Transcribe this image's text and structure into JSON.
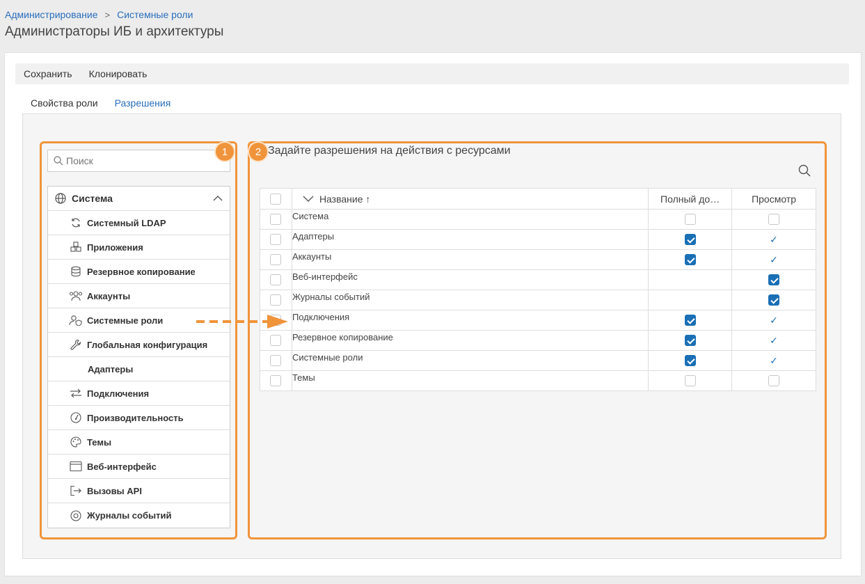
{
  "breadcrumb": {
    "root": "Администрирование",
    "current": "Системные роли"
  },
  "page_title": "Администраторы ИБ и архитектуры",
  "toolbar": {
    "save_label": "Сохранить",
    "clone_label": "Клонировать"
  },
  "tabs": [
    {
      "label": "Свойства роли"
    },
    {
      "label": "Разрешения"
    }
  ],
  "left": {
    "search_placeholder": "Поиск",
    "group_label": "Система",
    "items": [
      {
        "label": "Системный LDAP",
        "icon": "sync-icon"
      },
      {
        "label": "Приложения",
        "icon": "cubes-icon"
      },
      {
        "label": "Резервное копирование",
        "icon": "database-icon"
      },
      {
        "label": "Аккаунты",
        "icon": "users-icon"
      },
      {
        "label": "Системные роли",
        "icon": "user-shield-icon"
      },
      {
        "label": "Глобальная конфигурация",
        "icon": "wrench-icon"
      },
      {
        "label": "Адаптеры",
        "icon": ""
      },
      {
        "label": "Подключения",
        "icon": "arrows-exchange-icon"
      },
      {
        "label": "Производительность",
        "icon": "gauge-icon"
      },
      {
        "label": "Темы",
        "icon": "palette-icon"
      },
      {
        "label": "Веб-интерфейс",
        "icon": "browser-window-icon"
      },
      {
        "label": "Вызовы API",
        "icon": "api-exit-icon"
      },
      {
        "label": "Журналы событий",
        "icon": "event-log-icon"
      }
    ]
  },
  "right": {
    "title": "Задайте разрешения на действия с ресурсами",
    "columns": {
      "name": "Название ↑",
      "full": "Полный до…",
      "view": "Просмотр"
    },
    "rows": [
      {
        "name": "Система",
        "full": "unchecked",
        "view": "unchecked"
      },
      {
        "name": "Адаптеры",
        "full": "checked",
        "view": "implied"
      },
      {
        "name": "Аккаунты",
        "full": "checked",
        "view": "implied"
      },
      {
        "name": "Веб-интерфейс",
        "full": "none",
        "view": "checked"
      },
      {
        "name": "Журналы событий",
        "full": "none",
        "view": "checked"
      },
      {
        "name": "Подключения",
        "full": "checked",
        "view": "implied"
      },
      {
        "name": "Резервное копирование",
        "full": "checked",
        "view": "implied"
      },
      {
        "name": "Системные роли",
        "full": "checked",
        "view": "implied"
      },
      {
        "name": "Темы",
        "full": "unchecked",
        "view": "unchecked"
      }
    ]
  },
  "annotations": {
    "badge1": "1",
    "badge2": "2"
  },
  "colors": {
    "accent": "#2a6ebb",
    "annotation": "#f0943b",
    "checkbox": "#1a6fb5"
  }
}
